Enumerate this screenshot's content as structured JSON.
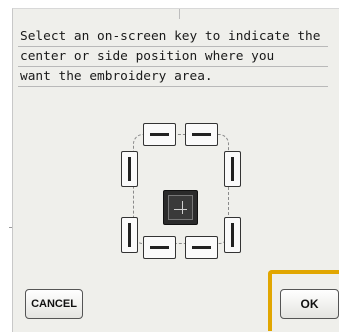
{
  "dialog": {
    "message_lines": [
      "Select an on-screen key to indicate the",
      "center or side position where you",
      "want the embroidery area."
    ]
  },
  "buttons": {
    "cancel_label": "CANCEL",
    "ok_label": "OK"
  },
  "highlight_color": "#e1a600",
  "position_keys": {
    "top": [
      "position-key-top-left",
      "position-key-top-right"
    ],
    "left": [
      "position-key-left-upper",
      "position-key-left-lower"
    ],
    "right": [
      "position-key-right-upper",
      "position-key-right-lower"
    ],
    "bottom": [
      "position-key-bottom-left",
      "position-key-bottom-right"
    ],
    "center": "crosshair-icon"
  }
}
